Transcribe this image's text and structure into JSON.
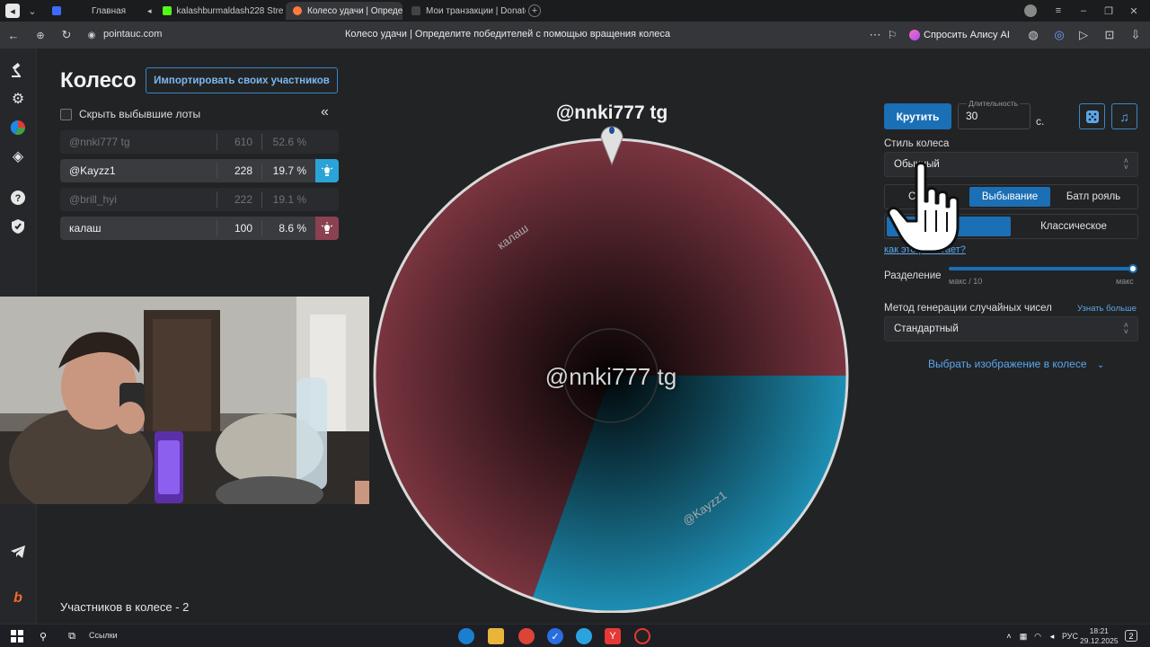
{
  "browser": {
    "tabs": [
      {
        "label": "Главная",
        "color": "#3d6bff"
      },
      {
        "label": "kalashburmaldash228 Stre",
        "color": "#53fc18"
      },
      {
        "label": "Колесо удачи | Определ",
        "color": "#ff7a3d"
      },
      {
        "label": "Мои транзакции | Donate",
        "color": "#2b2c2f"
      }
    ],
    "url": "pointauc.com",
    "page_title": "Колесо удачи | Определите победителей с помощью вращения колеса",
    "alice_button": "Спросить Алису AI"
  },
  "page": {
    "title": "Колесо",
    "import_button": "Импортировать своих участников",
    "hide_dropped": "Скрыть выбывшие лоты",
    "collapse_icon": "«",
    "participants_count": "Участников в колесе - 2"
  },
  "lots": [
    {
      "name": "@nnki777 tg",
      "amount": "610",
      "percent": "52.6 %",
      "state": "eliminated"
    },
    {
      "name": "@Kayzz1",
      "amount": "228",
      "percent": "19.7 %",
      "state": "active",
      "color": "#1e8fb4"
    },
    {
      "name": "@brill_hyi",
      "amount": "222",
      "percent": "19.1 %",
      "state": "eliminated"
    },
    {
      "name": "калаш",
      "amount": "100",
      "percent": "8.6 %",
      "state": "active",
      "color": "#7c3a45"
    }
  ],
  "wheel": {
    "winner_label": "@nnki777 tg",
    "center_label": "@nnki777 tg",
    "slices": [
      {
        "name": "калаш",
        "share": 0.696,
        "color": "#7a3540"
      },
      {
        "name": "@Kayzz1",
        "share": 0.304,
        "color": "#1e8fb4"
      }
    ]
  },
  "controls": {
    "spin_button": "Крутить",
    "duration_label": "Длительность",
    "duration_value": "30",
    "duration_unit": "с.",
    "style_label": "Стиль колеса",
    "style_value": "Обычный",
    "mode_tabs": [
      "С",
      "Выбывание",
      "Батл рояль"
    ],
    "mode_selected": "Выбывание",
    "variant_tabs": [
      "",
      "Классическое"
    ],
    "how_link": "как это работает?",
    "split_label": "Разделение",
    "split_min": "макс / 10",
    "split_max": "макс",
    "split_value": 1.0,
    "rng_label": "Метод генерации случайных чисел",
    "rng_more": "Узнать больше",
    "rng_value": "Стандартный",
    "image_link": "Выбрать изображение в колесе"
  },
  "taskbar": {
    "links": "Ссылки",
    "lang": "РУС",
    "time": "18:21",
    "date": "29.12.2025",
    "notif_count": "2"
  },
  "icons": {
    "gavel": "gavel-icon",
    "settings": "gear-icon",
    "wheel": "pie-icon",
    "layers": "layers-icon",
    "help": "help-icon",
    "shield": "shield-icon",
    "telegram": "telegram-icon",
    "boosty": "boosty-icon",
    "dice": "dice-icon",
    "music": "music-icon"
  }
}
